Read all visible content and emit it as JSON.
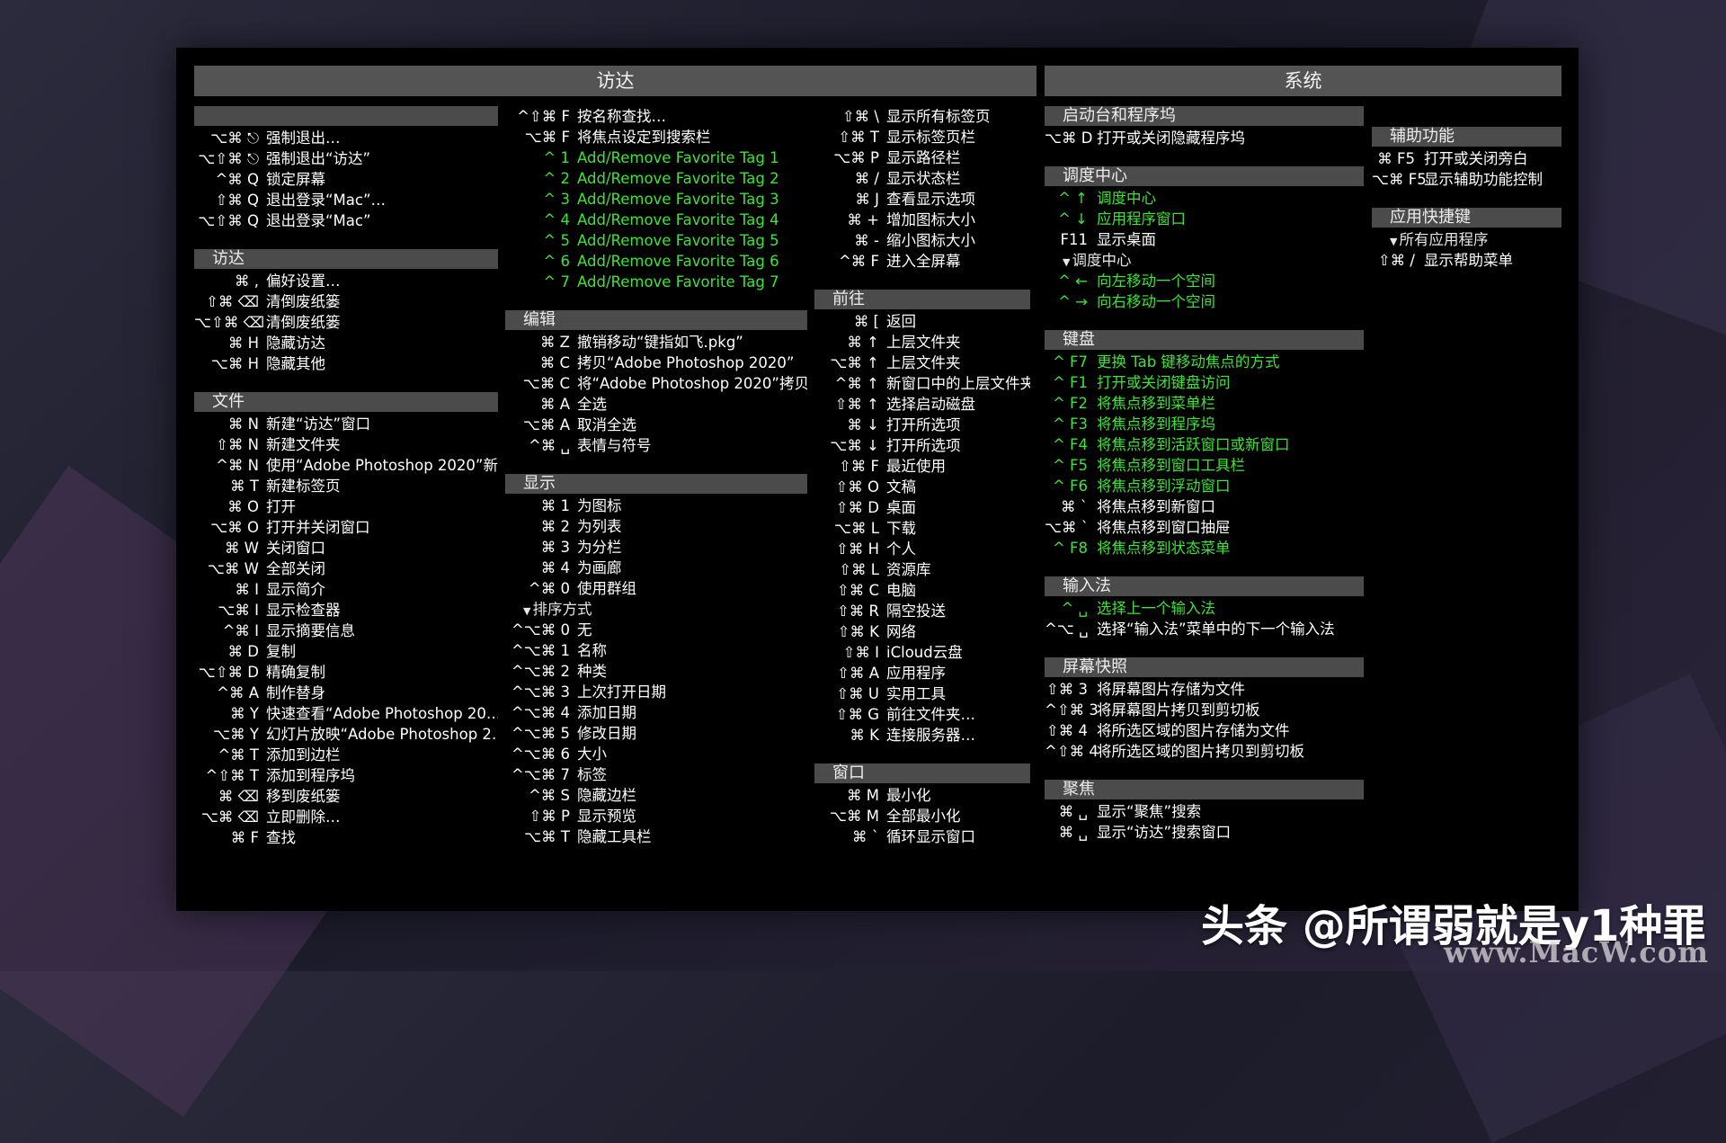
{
  "headers": {
    "finder": "访达",
    "system": "系统"
  },
  "col1": [
    {
      "title": "",
      "title_icon": "apple-logo-icon",
      "items": [
        {
          "k": "⌥⌘ ⎋",
          "l": "强制退出…"
        },
        {
          "k": "⌥⇧⌘ ⎋",
          "l": "强制退出“访达”"
        },
        {
          "k": "^⌘ Q",
          "l": "锁定屏幕"
        },
        {
          "k": "⇧⌘ Q",
          "l": "退出登录“Mac”…"
        },
        {
          "k": "⌥⇧⌘ Q",
          "l": "退出登录“Mac”"
        }
      ]
    },
    {
      "title": "访达",
      "items": [
        {
          "k": "⌘ ,",
          "l": "偏好设置…"
        },
        {
          "k": "⇧⌘ ⌫",
          "l": "清倒废纸篓"
        },
        {
          "k": "⌥⇧⌘ ⌫",
          "l": "清倒废纸篓"
        },
        {
          "k": "⌘ H",
          "l": "隐藏访达"
        },
        {
          "k": "⌥⌘ H",
          "l": "隐藏其他"
        }
      ]
    },
    {
      "title": "文件",
      "items": [
        {
          "k": "⌘ N",
          "l": "新建“访达”窗口"
        },
        {
          "k": "⇧⌘ N",
          "l": "新建文件夹"
        },
        {
          "k": "^⌘ N",
          "l": "使用“Adobe Photoshop 2020”新…"
        },
        {
          "k": "⌘ T",
          "l": "新建标签页"
        },
        {
          "k": "⌘ O",
          "l": "打开"
        },
        {
          "k": "⌥⌘ O",
          "l": "打开并关闭窗口"
        },
        {
          "k": "⌘ W",
          "l": "关闭窗口"
        },
        {
          "k": "⌥⌘ W",
          "l": "全部关闭"
        },
        {
          "k": "⌘ I",
          "l": "显示简介"
        },
        {
          "k": "⌥⌘ I",
          "l": "显示检查器"
        },
        {
          "k": "^⌘ I",
          "l": "显示摘要信息"
        },
        {
          "k": "⌘ D",
          "l": "复制"
        },
        {
          "k": "⌥⇧⌘ D",
          "l": "精确复制"
        },
        {
          "k": "^⌘ A",
          "l": "制作替身"
        },
        {
          "k": "⌘ Y",
          "l": "快速查看“Adobe Photoshop 20…"
        },
        {
          "k": "⌥⌘ Y",
          "l": "幻灯片放映“Adobe Photoshop 2…"
        },
        {
          "k": "^⌘ T",
          "l": "添加到边栏"
        },
        {
          "k": "^⇧⌘ T",
          "l": "添加到程序坞"
        },
        {
          "k": "⌘ ⌫",
          "l": "移到废纸篓"
        },
        {
          "k": "⌥⌘ ⌫",
          "l": "立即删除…"
        },
        {
          "k": "⌘ F",
          "l": "查找"
        }
      ]
    }
  ],
  "col2": [
    {
      "title": "",
      "items": [
        {
          "k": "^⇧⌘ F",
          "l": "按名称查找…"
        },
        {
          "k": "⌥⌘ F",
          "l": "将焦点设定到搜索栏"
        },
        {
          "k": "^ 1",
          "l": "Add/Remove Favorite Tag 1",
          "g": true
        },
        {
          "k": "^ 2",
          "l": "Add/Remove Favorite Tag 2",
          "g": true
        },
        {
          "k": "^ 3",
          "l": "Add/Remove Favorite Tag 3",
          "g": true
        },
        {
          "k": "^ 4",
          "l": "Add/Remove Favorite Tag 4",
          "g": true
        },
        {
          "k": "^ 5",
          "l": "Add/Remove Favorite Tag 5",
          "g": true
        },
        {
          "k": "^ 6",
          "l": "Add/Remove Favorite Tag 6",
          "g": true
        },
        {
          "k": "^ 7",
          "l": "Add/Remove Favorite Tag 7",
          "g": true
        }
      ]
    },
    {
      "title": "编辑",
      "items": [
        {
          "k": "⌘ Z",
          "l": "撤销移动“键指如飞.pkg”"
        },
        {
          "k": "⌘ C",
          "l": "拷贝“Adobe Photoshop 2020”"
        },
        {
          "k": "⌥⌘ C",
          "l": "将“Adobe Photoshop 2020”拷贝…"
        },
        {
          "k": "⌘ A",
          "l": "全选"
        },
        {
          "k": "⌥⌘ A",
          "l": "取消全选"
        },
        {
          "k": "^⌘ ␣",
          "l": "表情与符号"
        }
      ]
    },
    {
      "title": "显示",
      "items": [
        {
          "k": "⌘ 1",
          "l": "为图标"
        },
        {
          "k": "⌘ 2",
          "l": "为列表"
        },
        {
          "k": "⌘ 3",
          "l": "为分栏"
        },
        {
          "k": "⌘ 4",
          "l": "为画廊"
        },
        {
          "k": "^⌘ 0",
          "l": "使用群组"
        },
        {
          "sub": "排序方式"
        },
        {
          "k": "^⌥⌘ 0",
          "l": "无"
        },
        {
          "k": "^⌥⌘ 1",
          "l": "名称"
        },
        {
          "k": "^⌥⌘ 2",
          "l": "种类"
        },
        {
          "k": "^⌥⌘ 3",
          "l": "上次打开日期"
        },
        {
          "k": "^⌥⌘ 4",
          "l": "添加日期"
        },
        {
          "k": "^⌥⌘ 5",
          "l": "修改日期"
        },
        {
          "k": "^⌥⌘ 6",
          "l": "大小"
        },
        {
          "k": "^⌥⌘ 7",
          "l": "标签"
        },
        {
          "k": "^⌘ S",
          "l": "隐藏边栏"
        },
        {
          "k": "⇧⌘ P",
          "l": "显示预览"
        },
        {
          "k": "⌥⌘ T",
          "l": "隐藏工具栏"
        }
      ]
    }
  ],
  "col3": [
    {
      "title": "",
      "items": [
        {
          "k": "⇧⌘ \\",
          "l": "显示所有标签页"
        },
        {
          "k": "⇧⌘ T",
          "l": "显示标签页栏"
        },
        {
          "k": "⌥⌘ P",
          "l": "显示路径栏"
        },
        {
          "k": "⌘ /",
          "l": "显示状态栏"
        },
        {
          "k": "⌘ J",
          "l": "查看显示选项"
        },
        {
          "k": "⌘ +",
          "l": "增加图标大小"
        },
        {
          "k": "⌘ -",
          "l": "缩小图标大小"
        },
        {
          "k": "^⌘ F",
          "l": "进入全屏幕"
        }
      ]
    },
    {
      "title": "前往",
      "items": [
        {
          "k": "⌘ [",
          "l": "返回"
        },
        {
          "k": "⌘ ↑",
          "l": "上层文件夹"
        },
        {
          "k": "⌥⌘ ↑",
          "l": "上层文件夹"
        },
        {
          "k": "^⌘ ↑",
          "l": "新窗口中的上层文件夹"
        },
        {
          "k": "⇧⌘ ↑",
          "l": "选择启动磁盘"
        },
        {
          "k": "⌘ ↓",
          "l": "打开所选项"
        },
        {
          "k": "⌥⌘ ↓",
          "l": "打开所选项"
        },
        {
          "k": "⇧⌘ F",
          "l": "最近使用"
        },
        {
          "k": "⇧⌘ O",
          "l": "文稿"
        },
        {
          "k": "⇧⌘ D",
          "l": "桌面"
        },
        {
          "k": "⌥⌘ L",
          "l": "下载"
        },
        {
          "k": "⇧⌘ H",
          "l": "个人"
        },
        {
          "k": "⇧⌘ L",
          "l": "资源库"
        },
        {
          "k": "⇧⌘ C",
          "l": "电脑"
        },
        {
          "k": "⇧⌘ R",
          "l": "隔空投送"
        },
        {
          "k": "⇧⌘ K",
          "l": "网络"
        },
        {
          "k": "⇧⌘ I",
          "l": "iCloud云盘"
        },
        {
          "k": "⇧⌘ A",
          "l": "应用程序"
        },
        {
          "k": "⇧⌘ U",
          "l": "实用工具"
        },
        {
          "k": "⇧⌘ G",
          "l": "前往文件夹…"
        },
        {
          "k": "⌘ K",
          "l": "连接服务器…"
        }
      ]
    },
    {
      "title": "窗口",
      "items": [
        {
          "k": "⌘ M",
          "l": "最小化"
        },
        {
          "k": "⌥⌘ M",
          "l": "全部最小化"
        },
        {
          "k": "⌘ `",
          "l": "循环显示窗口"
        }
      ]
    }
  ],
  "col4": [
    {
      "title": "启动台和程序坞",
      "items": [
        {
          "k": "⌥⌘ D",
          "l": "打开或关闭隐藏程序坞"
        }
      ]
    },
    {
      "title": "调度中心",
      "items": [
        {
          "k": "^ ↑",
          "l": "调度中心",
          "g": true
        },
        {
          "k": "^ ↓",
          "l": "应用程序窗口",
          "g": true
        },
        {
          "k": "F11",
          "l": "显示桌面"
        },
        {
          "sub": "调度中心"
        },
        {
          "k": "^ ←",
          "l": "向左移动一个空间",
          "g": true
        },
        {
          "k": "^ →",
          "l": "向右移动一个空间",
          "g": true
        }
      ]
    },
    {
      "title": "键盘",
      "items": [
        {
          "k": "^ F7",
          "l": "更换 Tab 键移动焦点的方式",
          "g": true
        },
        {
          "k": "^ F1",
          "l": "打开或关闭键盘访问",
          "g": true
        },
        {
          "k": "^ F2",
          "l": "将焦点移到菜单栏",
          "g": true
        },
        {
          "k": "^ F3",
          "l": "将焦点移到程序坞",
          "g": true
        },
        {
          "k": "^ F4",
          "l": "将焦点移到活跃窗口或新窗口",
          "g": true
        },
        {
          "k": "^ F5",
          "l": "将焦点移到窗口工具栏",
          "g": true
        },
        {
          "k": "^ F6",
          "l": "将焦点移到浮动窗口",
          "g": true
        },
        {
          "k": "⌘ `",
          "l": "将焦点移到新窗口"
        },
        {
          "k": "⌥⌘ `",
          "l": "将焦点移到窗口抽屉"
        },
        {
          "k": "^ F8",
          "l": "将焦点移到状态菜单",
          "g": true
        }
      ]
    },
    {
      "title": "输入法",
      "items": [
        {
          "k": "^ ␣",
          "l": "选择上一个输入法",
          "g": true
        },
        {
          "k": "^⌥ ␣",
          "l": "选择“输入法”菜单中的下一个输入法"
        }
      ]
    },
    {
      "title": "屏幕快照",
      "items": [
        {
          "k": "⇧⌘ 3",
          "l": "将屏幕图片存储为文件"
        },
        {
          "k": "^⇧⌘ 3",
          "l": "将屏幕图片拷贝到剪切板"
        },
        {
          "k": "⇧⌘ 4",
          "l": "将所选区域的图片存储为文件"
        },
        {
          "k": "^⇧⌘ 4",
          "l": "将所选区域的图片拷贝到剪切板"
        }
      ]
    },
    {
      "title": "聚焦",
      "items": [
        {
          "k": "⌘ ␣",
          "l": "显示“聚焦”搜索"
        },
        {
          "k": "⌘ ␣",
          "l": "显示“访达”搜索窗口"
        }
      ]
    }
  ],
  "col5": [
    {
      "title": "辅助功能",
      "items": [
        {
          "k": "⌘ F5",
          "l": "打开或关闭旁白"
        },
        {
          "k": "⌥⌘ F5",
          "l": "显示辅助功能控制"
        }
      ]
    },
    {
      "title": "应用快捷键",
      "items": [
        {
          "sub": "所有应用程序"
        },
        {
          "k": "⇧⌘ /",
          "l": "显示帮助菜单"
        }
      ]
    }
  ],
  "watermark": "头条 @所谓弱就是y1种罪",
  "watermark2": "www.MacW.com",
  "colors": {
    "panel": "#000000",
    "header": "#545454",
    "section": "#4b4b4b",
    "green": "#3de336",
    "text": "#ffffff"
  }
}
